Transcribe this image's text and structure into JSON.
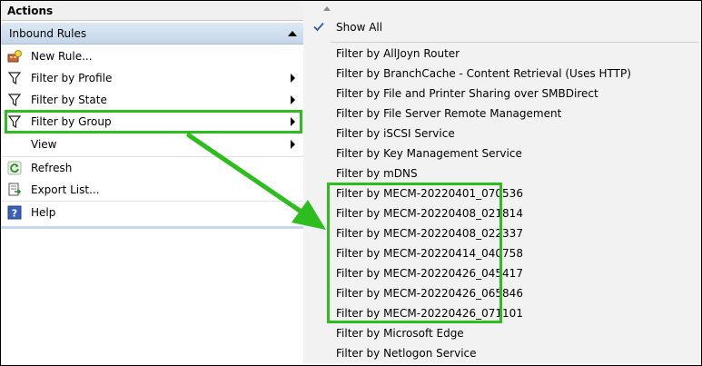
{
  "actions": {
    "title": "Actions",
    "group_title": "Inbound Rules",
    "items": [
      {
        "label": "New Rule...",
        "icon": "new-rule-icon"
      },
      {
        "label": "Filter by Profile",
        "icon": "filter-icon",
        "submenu": true
      },
      {
        "label": "Filter by State",
        "icon": "filter-icon",
        "submenu": true
      },
      {
        "label": "Filter by Group",
        "icon": "filter-icon",
        "submenu": true
      },
      {
        "label": "View",
        "submenu": true
      },
      {
        "label": "Refresh",
        "icon": "refresh-icon"
      },
      {
        "label": "Export List...",
        "icon": "export-icon"
      },
      {
        "label": "Help",
        "icon": "help-icon"
      }
    ]
  },
  "dropdown": {
    "show_all": "Show All",
    "items": [
      "Filter by AllJoyn Router",
      "Filter by BranchCache - Content Retrieval (Uses HTTP)",
      "Filter by File and Printer Sharing over SMBDirect",
      "Filter by File Server Remote Management",
      "Filter by iSCSI Service",
      "Filter by Key Management Service",
      "Filter by mDNS",
      "Filter by MECM-20220401_070536",
      "Filter by MECM-20220408_021814",
      "Filter by MECM-20220408_022337",
      "Filter by MECM-20220414_040758",
      "Filter by MECM-20220426_045417",
      "Filter by MECM-20220426_065846",
      "Filter by MECM-20220426_071101",
      "Filter by Microsoft Edge",
      "Filter by Netlogon Service"
    ]
  },
  "colors": {
    "highlight": "#2ebd1e",
    "header_blue": "#c6d6ea"
  }
}
